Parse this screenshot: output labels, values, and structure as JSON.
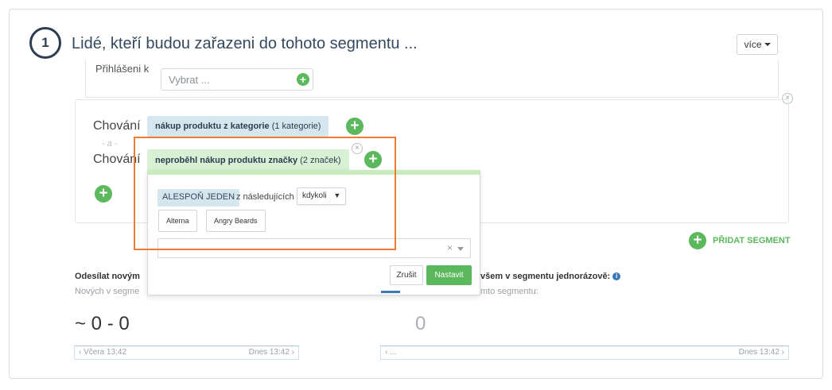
{
  "segment": {
    "step_number": "1",
    "title": "Lidé, kteří budou zařazeni do tohoto segmentu ...",
    "more_label": "více"
  },
  "login": {
    "label": "Přihlášeni k",
    "select_placeholder": "Vybrat ..."
  },
  "behavior": {
    "row1_label": "Chování",
    "row1_tag_bold": "nákup produktu z kategorie",
    "row1_tag_rest": "(1 kategorie)",
    "and_separator": "- a -",
    "row2_label": "Chování",
    "row2_tag_bold": "neproběhl nákup produktu značky",
    "row2_tag_rest": "(2 značek)"
  },
  "popover": {
    "quantifier": "ALESPOŇ JEDEN",
    "from_following": "z následujících",
    "time_select": "kdykoli",
    "brands": [
      "Alterna",
      "Angry Beards"
    ],
    "cancel_label": "Zrušit",
    "set_label": "Nastavit"
  },
  "add_segment_label": "PŘIDAT SEGMENT",
  "send_new": {
    "label": "Odesílat novým",
    "sub": "Nových v segme",
    "count": "~ 0 - 0",
    "range_left": "‹ Včera 13:42",
    "range_right": "Dnes 13:42 ›"
  },
  "send_all": {
    "label": "všem v segmentu jednorázově:",
    "sub": "mto segmentu:",
    "count": "0",
    "range_left": "‹ ...",
    "range_right": "Dnes 13:42 ›"
  },
  "colors": {
    "accent_green": "#5cb85c",
    "highlight_orange": "#ee7d31",
    "tag_blue": "#d6e6ee",
    "tag_green": "#d8f0d4"
  },
  "icons": {
    "add": "plus-circle-icon",
    "remove": "close-circle-icon",
    "info": "info-icon",
    "dropdown": "chevron-down-icon"
  }
}
